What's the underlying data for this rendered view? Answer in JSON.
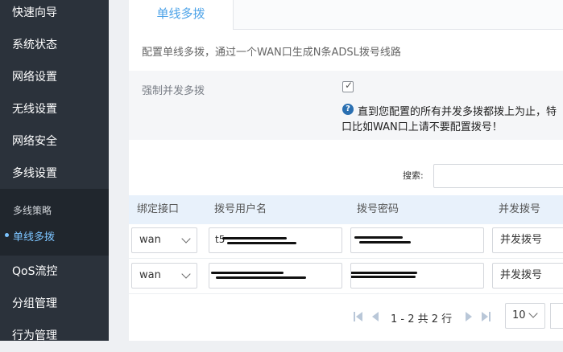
{
  "sidebar": {
    "items": [
      {
        "label": "快速向导"
      },
      {
        "label": "系统状态"
      },
      {
        "label": "网络设置"
      },
      {
        "label": "无线设置"
      },
      {
        "label": "网络安全"
      },
      {
        "label": "多线设置"
      }
    ],
    "submenu": [
      {
        "label": "多线策略"
      },
      {
        "label": "单线多拨",
        "active": true
      }
    ],
    "items_after": [
      {
        "label": "QoS流控"
      },
      {
        "label": "分组管理"
      },
      {
        "label": "行为管理"
      }
    ]
  },
  "main": {
    "tab": "单线多拨",
    "description": "配置单线多拨，通过一个WAN口生成N条ADSL拨号线路",
    "force_option": {
      "label": "强制并发多拨",
      "checked": true,
      "note_line1": "直到您配置的所有并发多拨都拨上为止，特",
      "note_line2": "口比如WAN口上请不要配置拨号！"
    },
    "search": {
      "label": "搜索:",
      "value": ""
    },
    "table": {
      "headers": [
        "绑定接口",
        "拨号用户名",
        "拨号密码",
        "并发拨号"
      ],
      "rows": [
        {
          "interface": "wan",
          "username": "t5",
          "password": "",
          "concurrent": "并发拨号"
        },
        {
          "interface": "wan",
          "username": "",
          "password": "",
          "concurrent": "并发拨号"
        }
      ]
    },
    "pagination": {
      "info": "1 - 2 共 2 行",
      "page_size": "10"
    }
  },
  "colors": {
    "sidebar_bg": "#2b323b",
    "submenu_bg": "#20262d",
    "accent": "#4da3e8",
    "table_header_bg": "#e8f1fb"
  },
  "icons": [
    "checkbox-checked-icon",
    "help-icon",
    "chevron-down-icon",
    "first-page-icon",
    "prev-page-icon",
    "next-page-icon",
    "last-page-icon"
  ]
}
